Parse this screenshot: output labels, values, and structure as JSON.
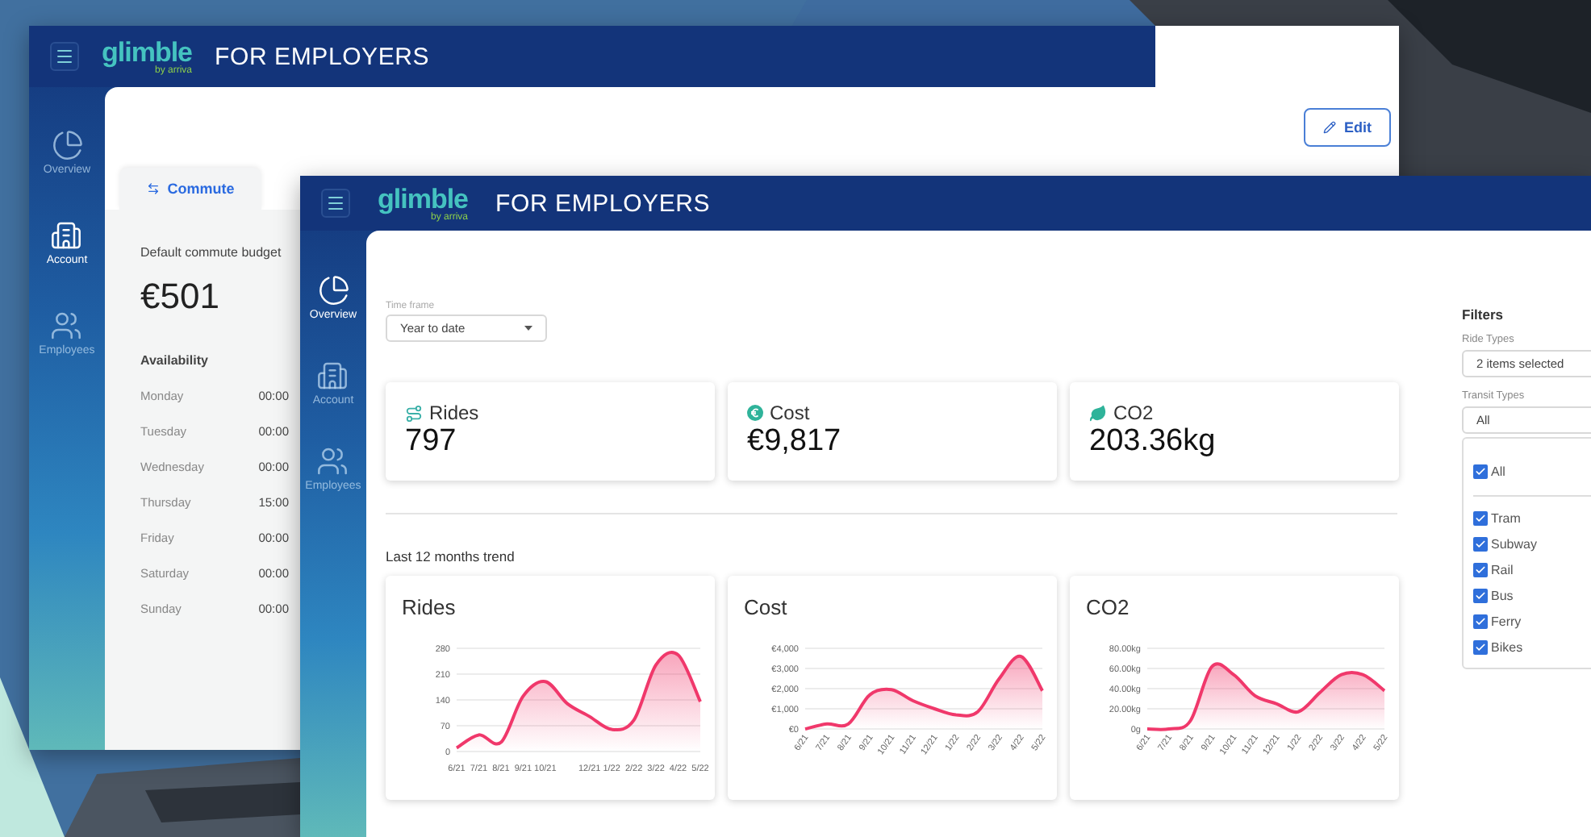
{
  "back_window": {
    "header": {
      "logo": "glimble",
      "logo_sub": "by arriva",
      "title": "FOR EMPLOYERS"
    },
    "sidebar": {
      "items": [
        {
          "kind": "overview",
          "label": "Overview",
          "selected": false
        },
        {
          "kind": "account",
          "label": "Account",
          "selected": true
        },
        {
          "kind": "employees",
          "label": "Employees",
          "selected": false
        }
      ]
    },
    "edit_button": "Edit",
    "tabs": [
      {
        "label": "Commute",
        "selected": true
      }
    ],
    "budget": {
      "label": "Default commute budget",
      "value": "€501"
    },
    "availability": {
      "title": "Availability",
      "rows": [
        {
          "day": "Monday",
          "time": "00:00"
        },
        {
          "day": "Tuesday",
          "time": "00:00"
        },
        {
          "day": "Wednesday",
          "time": "00:00"
        },
        {
          "day": "Thursday",
          "time": "15:00"
        },
        {
          "day": "Friday",
          "time": "00:00"
        },
        {
          "day": "Saturday",
          "time": "00:00"
        },
        {
          "day": "Sunday",
          "time": "00:00"
        }
      ]
    }
  },
  "front_window": {
    "header": {
      "logo": "glimble",
      "logo_sub": "by arriva",
      "title": "FOR EMPLOYERS"
    },
    "sidebar": {
      "items": [
        {
          "kind": "overview",
          "label": "Overview",
          "selected": true
        },
        {
          "kind": "account",
          "label": "Account",
          "selected": false
        },
        {
          "kind": "employees",
          "label": "Employees",
          "selected": false
        }
      ]
    },
    "time_frame": {
      "label": "Time frame",
      "value": "Year to date"
    },
    "stats": [
      {
        "kind": "rides",
        "label": "Rides",
        "value": "797"
      },
      {
        "kind": "cost",
        "label": "Cost",
        "value": "€9,817"
      },
      {
        "kind": "co2",
        "label": "CO2",
        "value": "203.36kg"
      }
    ],
    "trend_title": "Last 12 months trend",
    "charts": [
      {
        "chart_data": {
          "type": "area",
          "title": "Rides",
          "categories": [
            "6/21",
            "7/21",
            "8/21",
            "9/21",
            "10/21",
            null,
            "12/21",
            "1/22",
            "2/22",
            "3/22",
            "4/22",
            "5/22"
          ],
          "series": [
            {
              "color": "#f0386b",
              "values": [
                10,
                45,
                25,
                150,
                190,
                130,
                95,
                60,
                85,
                235,
                262,
                135
              ]
            }
          ],
          "ylim": [
            0,
            280
          ],
          "yticks": [
            0,
            70,
            140,
            210,
            280
          ],
          "grid": true
        }
      },
      {
        "chart_data": {
          "type": "area",
          "title": "Cost",
          "categories": [
            "6/21",
            "7/21",
            "8/21",
            "9/21",
            "10/21",
            "11/21",
            "12/21",
            "1/22",
            "2/22",
            "3/22",
            "4/22",
            "5/22"
          ],
          "series": [
            {
              "color": "#f0386b",
              "values": [
                0,
                250,
                250,
                1700,
                1950,
                1400,
                1000,
                700,
                850,
                2500,
                3600,
                1900
              ]
            }
          ],
          "grid": true,
          "ylim": [
            0,
            4000
          ],
          "yticks": [
            {
              "value": 0,
              "label": "€0"
            },
            {
              "value": 1000,
              "label": "€1,000"
            },
            {
              "value": 2000,
              "label": "€2,000"
            },
            {
              "value": 3000,
              "label": "€3,000"
            },
            {
              "value": 4000,
              "label": "€4,000"
            }
          ]
        }
      },
      {
        "chart_data": {
          "type": "area",
          "title": "CO2",
          "categories": [
            "6/21",
            "7/21",
            "8/21",
            "9/21",
            "10/21",
            "11/21",
            "12/21",
            "1/22",
            "2/22",
            "3/22",
            "4/22",
            "5/22"
          ],
          "series": [
            {
              "color": "#f0386b",
              "values": [
                0,
                0,
                8,
                62,
                54,
                33,
                25,
                17,
                36,
                54,
                54,
                38
              ]
            }
          ],
          "grid": true,
          "ylim": [
            0,
            80
          ],
          "yticks": [
            {
              "value": 0,
              "label": "0g"
            },
            {
              "value": 20,
              "label": "20.00kg"
            },
            {
              "value": 40,
              "label": "40.00kg"
            },
            {
              "value": 60,
              "label": "60.00kg"
            },
            {
              "value": 80,
              "label": "80.00kg"
            }
          ]
        }
      }
    ],
    "filters": {
      "title": "Filters",
      "ride_types": {
        "label": "Ride Types",
        "value": "2 items selected"
      },
      "transit_types": {
        "label": "Transit Types",
        "value": "All"
      },
      "options": [
        {
          "kind": "all",
          "label": "All",
          "checked": true
        },
        {
          "kind": "item",
          "label": "Tram",
          "checked": true
        },
        {
          "kind": "item",
          "label": "Subway",
          "checked": true
        },
        {
          "kind": "item",
          "label": "Rail",
          "checked": true
        },
        {
          "kind": "item",
          "label": "Bus",
          "checked": true
        },
        {
          "kind": "item",
          "label": "Ferry",
          "checked": true
        },
        {
          "kind": "item",
          "label": "Bikes",
          "checked": true
        }
      ]
    }
  }
}
